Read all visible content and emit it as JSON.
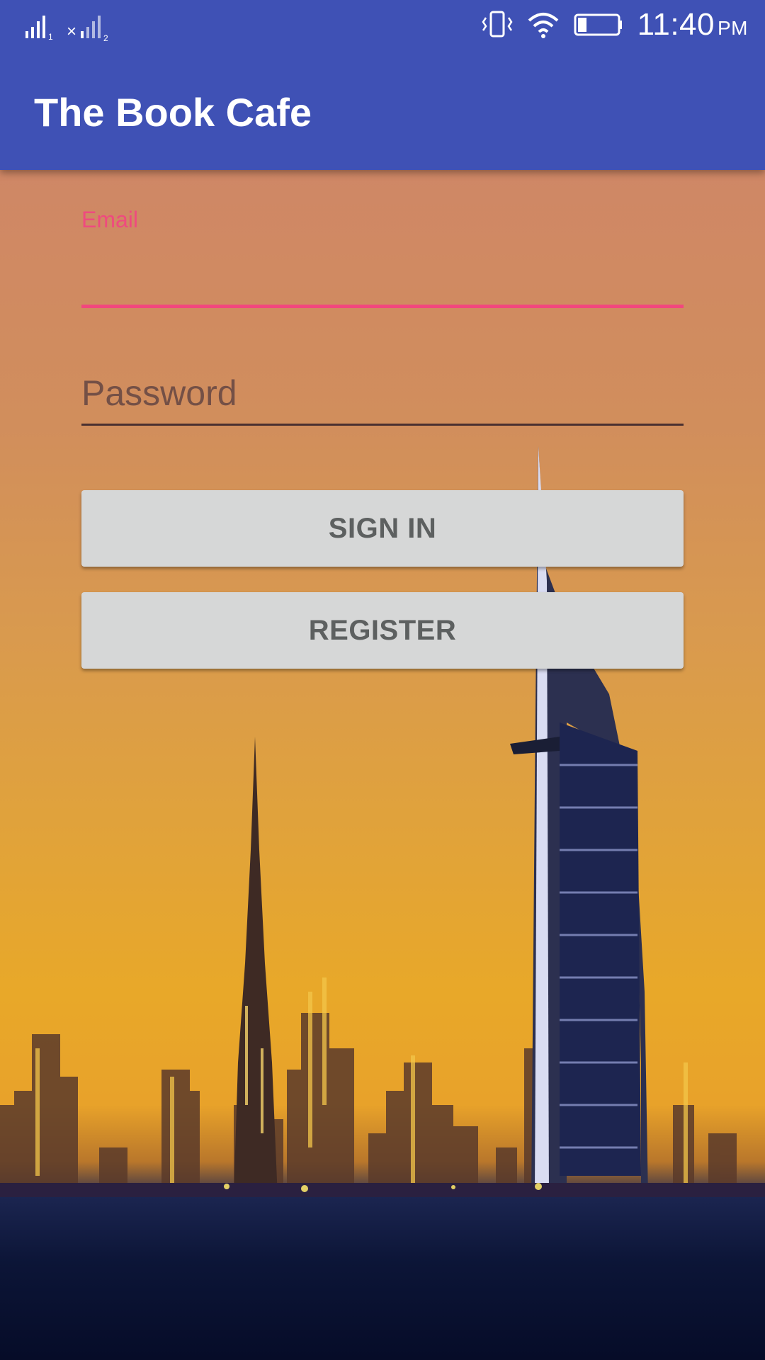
{
  "status_bar": {
    "time": "11:40",
    "ampm": "PM",
    "icons": [
      "signal-sim1-icon",
      "signal-sim2-icon",
      "vibrate-icon",
      "wifi-icon",
      "battery-icon"
    ]
  },
  "app_bar": {
    "title": "The Book Cafe",
    "color": "#3f51b5"
  },
  "login_form": {
    "email_label": "Email",
    "email_value": "",
    "password_placeholder": "Password",
    "password_value": "",
    "sign_in_label": "SIGN IN",
    "register_label": "REGISTER",
    "accent_color": "#ef4a7f"
  },
  "background": {
    "description": "city-skyline-at-sunset"
  }
}
